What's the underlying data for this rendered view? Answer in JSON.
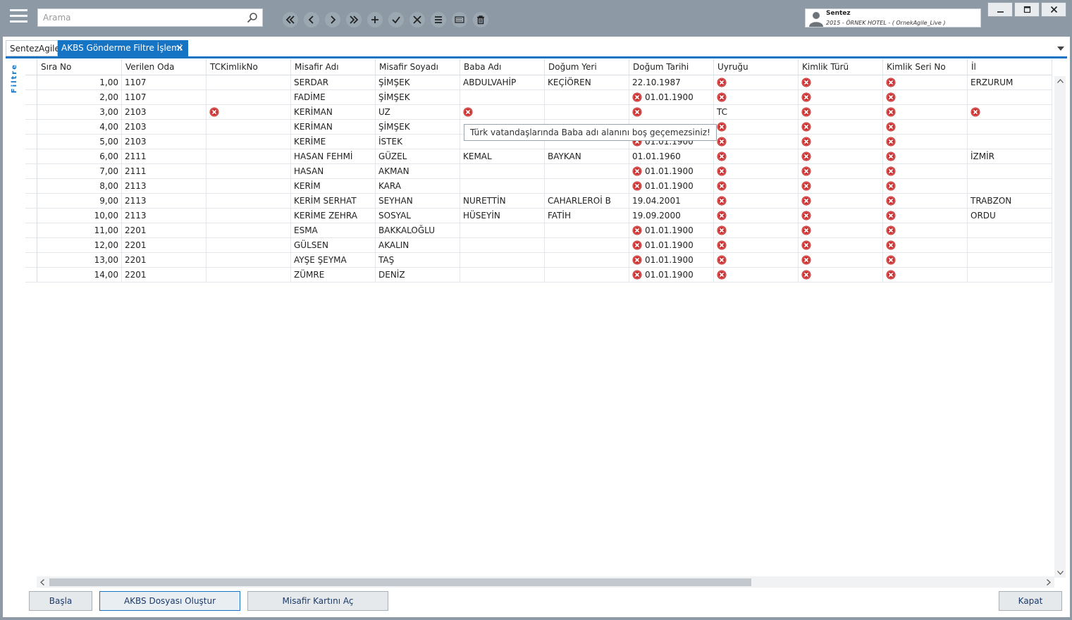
{
  "topbar": {
    "search_placeholder": "Arama",
    "user": {
      "name": "Sentez",
      "info": "2015 - ÖRNEK HOTEL - ( OrnekAgile_Live )"
    }
  },
  "tabs": [
    {
      "label": "SentezAgile"
    },
    {
      "label": "AKBS Gönderme Filtre İşlemi",
      "close": "×"
    }
  ],
  "sidebar": {
    "label": "Filtre"
  },
  "grid": {
    "columns": [
      "Sıra No",
      "Verilen Oda",
      "TCKimlikNo",
      "Misafir Adı",
      "Misafir Soyadı",
      "Baba Adı",
      "Doğum Yeri",
      "Doğum Tarihi",
      "Uyruğu",
      "Kimlik Türü",
      "Kimlik Seri No",
      "İl"
    ],
    "rows": [
      {
        "sira": "1,00",
        "oda": "1107",
        "tc": "",
        "ad": "SERDAR",
        "soyad": "ŞİMŞEK",
        "baba": "ABDULVAHİP",
        "dyeri": "KEÇİÖREN",
        "dtarih": "22.10.1987",
        "uyruk": "",
        "kturu": "",
        "kseri": "",
        "il": "ERZURUM"
      },
      {
        "sira": "2,00",
        "oda": "1107",
        "tc": "",
        "ad": "FADİME",
        "soyad": "ŞİMŞEK",
        "baba": "",
        "dyeri": "",
        "dtarih": "01.01.1900",
        "uyruk": "",
        "kturu": "",
        "kseri": "",
        "il": ""
      },
      {
        "sira": "3,00",
        "oda": "2103",
        "tc": "",
        "ad": "KERİMAN",
        "soyad": "UZ",
        "baba": "",
        "dyeri": "",
        "dtarih": "",
        "uyruk": "TC",
        "kturu": "",
        "kseri": "",
        "il": ""
      },
      {
        "sira": "4,00",
        "oda": "2103",
        "tc": "",
        "ad": "KERİMAN",
        "soyad": "ŞİMŞEK",
        "baba": "",
        "dyeri": "",
        "dtarih": "",
        "uyruk": "",
        "kturu": "",
        "kseri": "",
        "il": ""
      },
      {
        "sira": "5,00",
        "oda": "2103",
        "tc": "",
        "ad": "KERİME",
        "soyad": "İSTEK",
        "baba": "",
        "dyeri": "",
        "dtarih": "01.01.1900",
        "uyruk": "",
        "kturu": "",
        "kseri": "",
        "il": ""
      },
      {
        "sira": "6,00",
        "oda": "2111",
        "tc": "",
        "ad": "HASAN FEHMİ",
        "soyad": "GÜZEL",
        "baba": "KEMAL",
        "dyeri": "BAYKAN",
        "dtarih": "01.01.1960",
        "uyruk": "",
        "kturu": "",
        "kseri": "",
        "il": "İZMİR"
      },
      {
        "sira": "7,00",
        "oda": "2111",
        "tc": "",
        "ad": "HASAN",
        "soyad": "AKMAN",
        "baba": "",
        "dyeri": "",
        "dtarih": "01.01.1900",
        "uyruk": "",
        "kturu": "",
        "kseri": "",
        "il": ""
      },
      {
        "sira": "8,00",
        "oda": "2113",
        "tc": "",
        "ad": "KERİM",
        "soyad": "KARA",
        "baba": "",
        "dyeri": "",
        "dtarih": "01.01.1900",
        "uyruk": "",
        "kturu": "",
        "kseri": "",
        "il": ""
      },
      {
        "sira": "9,00",
        "oda": "2113",
        "tc": "",
        "ad": "KERİM SERHAT",
        "soyad": "SEYHAN",
        "baba": "NURETTİN",
        "dyeri": "CAHARLEROİ B",
        "dtarih": "19.04.2001",
        "uyruk": "",
        "kturu": "",
        "kseri": "",
        "il": "TRABZON"
      },
      {
        "sira": "10,00",
        "oda": "2113",
        "tc": "",
        "ad": "KERİME ZEHRA",
        "soyad": "SOSYAL",
        "baba": "HÜSEYİN",
        "dyeri": "FATİH",
        "dtarih": "19.09.2000",
        "uyruk": "",
        "kturu": "",
        "kseri": "",
        "il": "ORDU"
      },
      {
        "sira": "11,00",
        "oda": "2201",
        "tc": "",
        "ad": "ESMA",
        "soyad": "BAKKALOĞLU",
        "baba": "",
        "dyeri": "",
        "dtarih": "01.01.1900",
        "uyruk": "",
        "kturu": "",
        "kseri": "",
        "il": ""
      },
      {
        "sira": "12,00",
        "oda": "2201",
        "tc": "",
        "ad": "GÜLSEN",
        "soyad": "AKALIN",
        "baba": "",
        "dyeri": "",
        "dtarih": "01.01.1900",
        "uyruk": "",
        "kturu": "",
        "kseri": "",
        "il": ""
      },
      {
        "sira": "13,00",
        "oda": "2201",
        "tc": "",
        "ad": "AYŞE ŞEYMA",
        "soyad": "TAŞ",
        "baba": "",
        "dyeri": "",
        "dtarih": "01.01.1900",
        "uyruk": "",
        "kturu": "",
        "kseri": "",
        "il": ""
      },
      {
        "sira": "14,00",
        "oda": "2201",
        "tc": "",
        "ad": "ZÜMRE",
        "soyad": "DENİZ",
        "baba": "",
        "dyeri": "",
        "dtarih": "01.01.1900",
        "uyruk": "",
        "kturu": "",
        "kseri": "",
        "il": ""
      }
    ],
    "errors": [
      [
        0,
        "uyruk"
      ],
      [
        0,
        "kturu"
      ],
      [
        0,
        "kseri"
      ],
      [
        1,
        "dtarih"
      ],
      [
        1,
        "uyruk"
      ],
      [
        1,
        "kturu"
      ],
      [
        1,
        "kseri"
      ],
      [
        2,
        "tc"
      ],
      [
        2,
        "baba"
      ],
      [
        2,
        "dtarih"
      ],
      [
        2,
        "kturu"
      ],
      [
        2,
        "kseri"
      ],
      [
        2,
        "il"
      ],
      [
        3,
        "uyruk"
      ],
      [
        3,
        "kturu"
      ],
      [
        3,
        "kseri"
      ],
      [
        4,
        "dtarih"
      ],
      [
        4,
        "uyruk"
      ],
      [
        4,
        "kturu"
      ],
      [
        4,
        "kseri"
      ],
      [
        5,
        "uyruk"
      ],
      [
        5,
        "kturu"
      ],
      [
        5,
        "kseri"
      ],
      [
        6,
        "dtarih"
      ],
      [
        6,
        "uyruk"
      ],
      [
        6,
        "kturu"
      ],
      [
        6,
        "kseri"
      ],
      [
        7,
        "dtarih"
      ],
      [
        7,
        "uyruk"
      ],
      [
        7,
        "kturu"
      ],
      [
        7,
        "kseri"
      ],
      [
        8,
        "uyruk"
      ],
      [
        8,
        "kturu"
      ],
      [
        8,
        "kseri"
      ],
      [
        9,
        "uyruk"
      ],
      [
        9,
        "kturu"
      ],
      [
        9,
        "kseri"
      ],
      [
        10,
        "dtarih"
      ],
      [
        10,
        "uyruk"
      ],
      [
        10,
        "kturu"
      ],
      [
        10,
        "kseri"
      ],
      [
        11,
        "dtarih"
      ],
      [
        11,
        "uyruk"
      ],
      [
        11,
        "kturu"
      ],
      [
        11,
        "kseri"
      ],
      [
        12,
        "dtarih"
      ],
      [
        12,
        "uyruk"
      ],
      [
        12,
        "kturu"
      ],
      [
        12,
        "kseri"
      ],
      [
        13,
        "dtarih"
      ],
      [
        13,
        "uyruk"
      ],
      [
        13,
        "kturu"
      ],
      [
        13,
        "kseri"
      ]
    ]
  },
  "tooltip": "Türk vatandaşlarında Baba adı alanını boş geçemezsiniz!",
  "buttons": {
    "basla": "Başla",
    "akbs": "AKBS Dosyası Oluştur",
    "misafir": "Misafir Kartını Aç",
    "kapat": "Kapat"
  },
  "icons": [
    "menu-icon",
    "search-icon",
    "first-icon",
    "prev-icon",
    "next-icon",
    "last-icon",
    "add-icon",
    "check-icon",
    "cancel-icon",
    "list-icon",
    "keyboard-icon",
    "trash-icon",
    "user-icon",
    "minimize-icon",
    "maximize-icon",
    "close-icon",
    "error-icon"
  ],
  "colors": {
    "accent": "#1574c4",
    "error": "#c62828",
    "chrome": "#8d9aa5"
  }
}
